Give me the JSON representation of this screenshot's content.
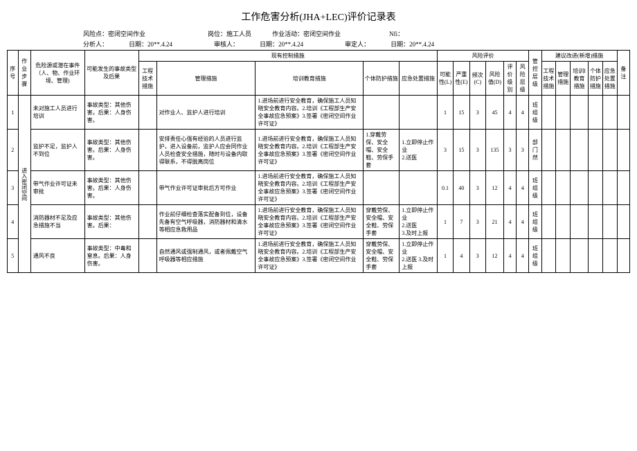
{
  "title": "工作危害分析(JHA+LEC)评价记录表",
  "meta": {
    "risk_point_label": "风险点：",
    "risk_point": "密闭空间作业",
    "post_label": "岗位：",
    "post": "施工人员",
    "activity_label": "作业活动：",
    "activity": "密闭空间作业",
    "nfi": "Nfi：",
    "analyst_label": "分析人：",
    "analyst_date_label": "日期：",
    "analyst_date": "20**.4.24",
    "reviewer_label": "审核人：",
    "reviewer_date_label": "日期：",
    "reviewer_date": "20**.4.24",
    "approver_label": "审定人：",
    "approver_date_label": "日期：",
    "approver_date": "20**.4.24"
  },
  "headers": {
    "seq": "序号",
    "step": "作业步骤",
    "hazard": "危险源或潜在事件（人、物、作业环境、管理)",
    "accident": "可能发生的事故类型及后果",
    "existing": "现有控制措施",
    "eng": "工程技术措施",
    "mgmt": "管理措施",
    "train": "培训教育措施",
    "ppe": "个体防护措施",
    "emer": "应急处置措施",
    "risk_eval": "风险评价",
    "L": "可能性(L)",
    "E": "严重性(E)",
    "C": "频次(C)",
    "D": "风险值(D)",
    "level": "评价级别",
    "risk_level": "风险层级",
    "control_level": "管控层级",
    "suggest": "建议改进(新增)措施",
    "s_eng": "工程技术措施",
    "s_mgmt": "管理措施",
    "s_train": "培训I教育措施",
    "s_ppe": "个体防护措施",
    "s_emer": "应急处置措施",
    "remark": "备注"
  },
  "step_group": "进入密闭空间",
  "rows": [
    {
      "no": "1",
      "hazard": "未对施工人员进行培训",
      "accident": "事故类型：其他伤害。后果：人身伤害。",
      "mgmt": "对作业人、监护人进行培训",
      "train": "1.进场前进行安全教育，确保施工人员知晓安全教育内容。2.培训《工程部生产安全事故应急预案》3.签署《密闭空间作业许可证》",
      "ppe": "",
      "emer": "",
      "L": "1",
      "E": "15",
      "C": "3",
      "D": "45",
      "lvl": "4",
      "rlvl": "4",
      "ctrl": "班组级"
    },
    {
      "no": "2",
      "hazard": "监护不足，监护人不到位",
      "accident": "事故类型：其他伤害。后果：人身伤害。",
      "mgmt": "安排责任心强有经验的人员进行监护，进入设备前，监护人应会同作业人员检查安全措施，随时与设备内取得联系，不得脱离岗位",
      "train": "1.进场前进行安全教育，确保施工人员知晓安全教育内容。2.培训《工程部生产安全事故应急预案》3.签署《密闭空间作业许可证》",
      "ppe": "1.穿戴劳保、安全帽、安全鞋、劳保手套",
      "emer": "1.立即停止作业\n2.送医",
      "L": "3",
      "E": "15",
      "C": "3",
      "D": "135",
      "lvl": "3",
      "rlvl": "3",
      "ctrl": "部门然"
    },
    {
      "no": "3",
      "hazard": "带气作业许可证未审批",
      "accident": "事故类型：其他伤害。后果：人身伤害。",
      "mgmt": "带气作业许可证审批后方可作业",
      "train": "1.进场前进行安全教育，确保施工人员知晓安全教育内容。2.培训《工程部生产安全事故应急预案》3.签署《密闭空间作业许可证》",
      "ppe": "",
      "emer": "",
      "L": "0.1",
      "E": "40",
      "C": "3",
      "D": "12",
      "lvl": "4",
      "rlvl": "4",
      "ctrl": "班组级"
    },
    {
      "no": "4",
      "hazard": "消防器材不足及应急措施不当",
      "accident": "事故类型：其他伤害。后果：",
      "mgmt": "作业前仔细检查落实配备到位，设备先备有空气呼吸器，消防器材和清水等相应急救用品",
      "train": "1.进场前进行安全教育，确保施工人员知晓安全教育内容。2.培训《工程部生产安全事故应急预案》3.签署《密闭空间作业许可证》",
      "ppe": "穿戴劳保、安全帽、安全鞋、劳保手套",
      "emer": "1.立即停止作业\n2.送医\n3.及时上报",
      "L": "1",
      "E": "7",
      "C": "3",
      "D": "21",
      "lvl": "4",
      "rlvl": "4",
      "ctrl": "班组级"
    },
    {
      "no": "5",
      "hazard": "通风不良",
      "accident": "事故类型：中毒和窒息。后果：人身伤害。",
      "mgmt": "自然通风或强制通风，或者佩戴空气呼吸器等相应措施",
      "train": "1.进场前进行安全教育，确保施工人员知晓安全教育内容。2.培训《工程部生产安全事故应急预案》3.签署《密闭空间作业许可证》",
      "ppe": "穿戴劳保、安全帽、安全鞋、劳保手套",
      "emer": "1.立即停止作业\n2.送医 3.及时上报",
      "L": "1",
      "E": "4",
      "C": "3",
      "D": "12",
      "lvl": "4",
      "rlvl": "4",
      "ctrl": "班组级"
    }
  ]
}
